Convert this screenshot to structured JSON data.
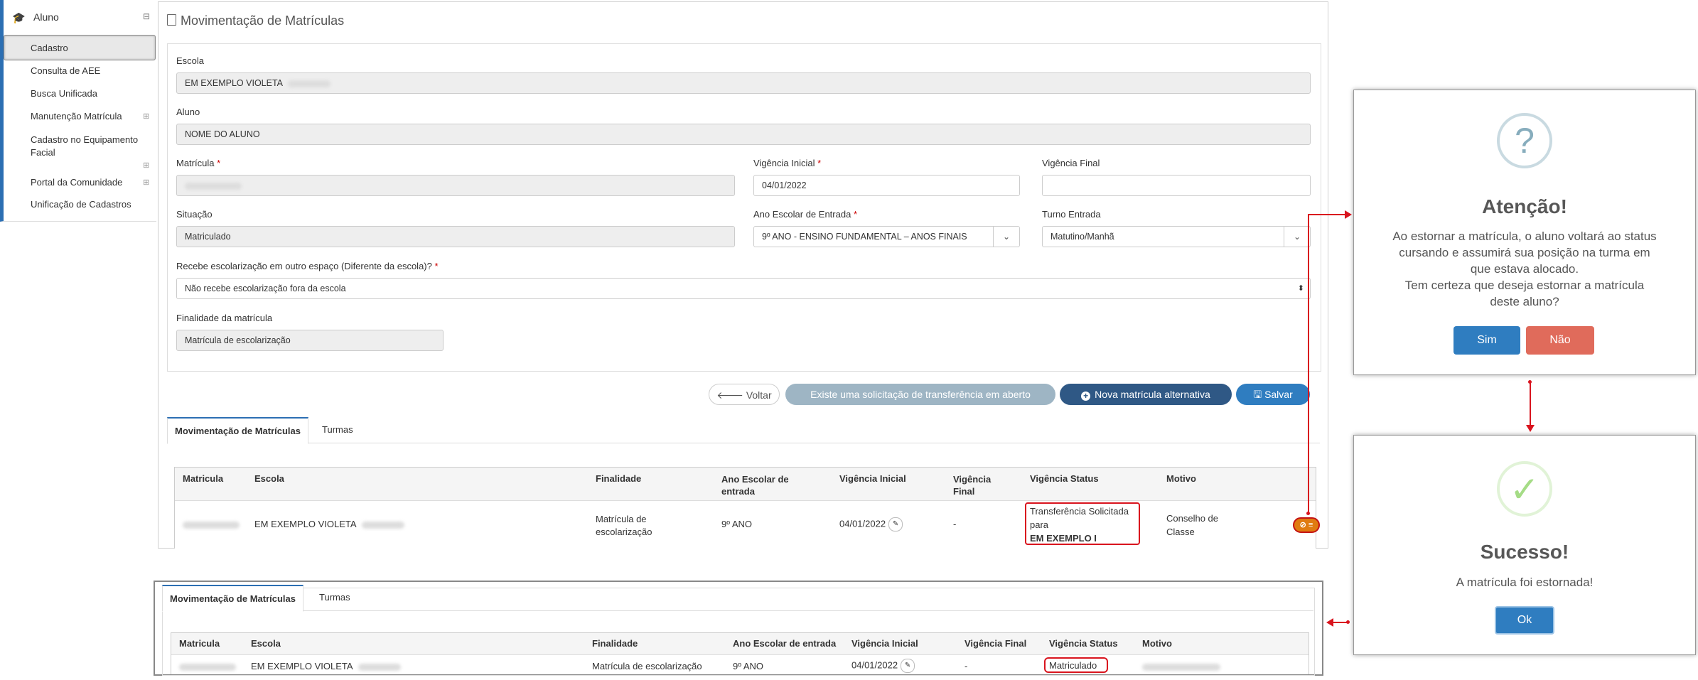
{
  "sidebar": {
    "section": "Aluno",
    "items": [
      {
        "label": "Cadastro"
      },
      {
        "label": "Consulta de AEE"
      },
      {
        "label": "Busca Unificada"
      },
      {
        "label": "Manutenção Matrícula"
      },
      {
        "label": "Cadastro no Equipamento Facial"
      },
      {
        "label": "Portal da Comunidade"
      },
      {
        "label": "Unificação de Cadastros"
      }
    ],
    "collapse_glyph": "⊟",
    "expand_glyph": "⊞"
  },
  "page": {
    "title": "Movimentação de Matrículas"
  },
  "form": {
    "escola_label": "Escola",
    "escola_value": "EM EXEMPLO VIOLETA",
    "aluno_label": "Aluno",
    "aluno_value": "NOME DO ALUNO",
    "matricula_label": "Matrícula",
    "vig_inicial_label": "Vigência Inicial",
    "vig_inicial_value": "04/01/2022",
    "vig_final_label": "Vigência Final",
    "vig_final_value": "",
    "situacao_label": "Situação",
    "situacao_value": "Matriculado",
    "ano_label": "Ano Escolar de Entrada",
    "ano_value": "9º ANO - ENSINO FUNDAMENTAL – ANOS FINAIS",
    "turno_label": "Turno Entrada",
    "turno_value": "Matutino/Manhã",
    "recebe_label": "Recebe escolarização em outro espaço (Diferente da escola)?",
    "recebe_value": "Não recebe escolarização fora da escola",
    "finalidade_label": "Finalidade da matrícula",
    "finalidade_value": "Matrícula de escolarização",
    "required_mark": "*"
  },
  "buttons": {
    "voltar": "Voltar",
    "existe": "Existe uma solicitação de transferência em aberto",
    "nova": "Nova matrícula alternativa",
    "salvar": "Salvar"
  },
  "tabs": {
    "mov": "Movimentação de Matrículas",
    "turmas": "Turmas"
  },
  "table_top": {
    "headers": [
      "Matricula",
      "Escola",
      "Finalidade",
      "Ano Escolar de entrada",
      "Vigência Inicial",
      "Vigência Final",
      "Vigência Status",
      "Motivo"
    ],
    "row": {
      "escola": "EM EXEMPLO VIOLETA",
      "finalidade": "Matrícula de escolarização",
      "ano": "9º ANO",
      "vig_inicial": "04/01/2022",
      "vig_final": "-",
      "status_line1": "Transferência Solicitada",
      "status_line2": "para",
      "status_line3": "EM EXEMPLO I",
      "motivo": "Conselho de Classe"
    }
  },
  "table_bottom": {
    "headers": [
      "Matricula",
      "Escola",
      "Finalidade",
      "Ano Escolar de entrada",
      "Vigência Inicial",
      "Vigência Final",
      "Vigência Status",
      "Motivo"
    ],
    "row": {
      "escola": "EM EXEMPLO VIOLETA",
      "finalidade": "Matrícula de escolarização",
      "ano": "9º ANO",
      "vig_inicial": "04/01/2022",
      "vig_final": "-",
      "status": "Matriculado"
    }
  },
  "dialog_confirm": {
    "icon": "?",
    "title": "Atenção!",
    "line1": "Ao estornar a matrícula, o aluno voltará ao status",
    "line2": "cursando e assumirá sua posição na turma em",
    "line3": "que estava alocado.",
    "line4": "Tem certeza que deseja estornar a matrícula",
    "line5": "deste aluno?",
    "sim": "Sim",
    "nao": "Não"
  },
  "dialog_success": {
    "icon": "✓",
    "title": "Sucesso!",
    "text": "A matrícula foi estornada!",
    "ok": "Ok"
  },
  "colors": {
    "primary": "#2f7dc0",
    "navy": "#2f5885",
    "danger": "#e06b5b",
    "annotation": "#d9141e",
    "success": "#a5dc86"
  }
}
